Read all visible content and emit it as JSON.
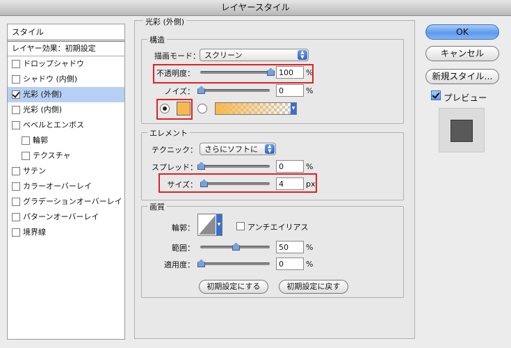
{
  "window": {
    "title": "レイヤースタイル"
  },
  "sidebar": {
    "header": "スタイル",
    "subheader": "レイヤー効果：初期設定",
    "items": [
      {
        "label": "ドロップシャドウ",
        "checked": false
      },
      {
        "label": "シャドウ (内側)",
        "checked": false
      },
      {
        "label": "光彩 (外側)",
        "checked": true,
        "selected": true
      },
      {
        "label": "光彩 (内側)",
        "checked": false
      },
      {
        "label": "ベベルとエンボス",
        "checked": false
      },
      {
        "label": "輪郭",
        "checked": false
      },
      {
        "label": "テクスチャ",
        "checked": false
      },
      {
        "label": "サテン",
        "checked": false
      },
      {
        "label": "カラーオーバーレイ",
        "checked": false
      },
      {
        "label": "グラデーションオーバーレイ",
        "checked": false
      },
      {
        "label": "パターンオーバーレイ",
        "checked": false
      },
      {
        "label": "境界線",
        "checked": false
      }
    ]
  },
  "panel": {
    "title": "光彩 (外側)",
    "structure": {
      "title": "構造",
      "blend_mode_label": "描画モード：",
      "blend_mode_value": "スクリーン",
      "opacity_label": "不透明度：",
      "opacity_value": "100",
      "opacity_unit": "%",
      "noise_label": "ノイズ：",
      "noise_value": "0",
      "noise_unit": "%",
      "glow_color": "#f7b84e",
      "color_mode": "solid"
    },
    "elements": {
      "title": "エレメント",
      "technique_label": "テクニック：",
      "technique_value": "さらにソフトに",
      "spread_label": "スプレッド：",
      "spread_value": "0",
      "spread_unit": "%",
      "size_label": "サイズ：",
      "size_value": "4",
      "size_unit": "px"
    },
    "quality": {
      "title": "画質",
      "contour_label": "輪郭：",
      "antialias_label": "アンチエイリアス",
      "antialias_checked": false,
      "range_label": "範囲：",
      "range_value": "50",
      "range_unit": "%",
      "jitter_label": "適用度：",
      "jitter_value": "0",
      "jitter_unit": "%"
    },
    "make_default_label": "初期設定にする",
    "reset_default_label": "初期設定に戻す"
  },
  "buttons": {
    "ok": "OK",
    "cancel": "キャンセル",
    "new_style": "新規スタイル...",
    "preview_label": "プレビュー",
    "preview_checked": true
  },
  "colors": {
    "highlight_box": "#e02020",
    "selection": "#b6cff4",
    "accent": "#5d9aed"
  }
}
